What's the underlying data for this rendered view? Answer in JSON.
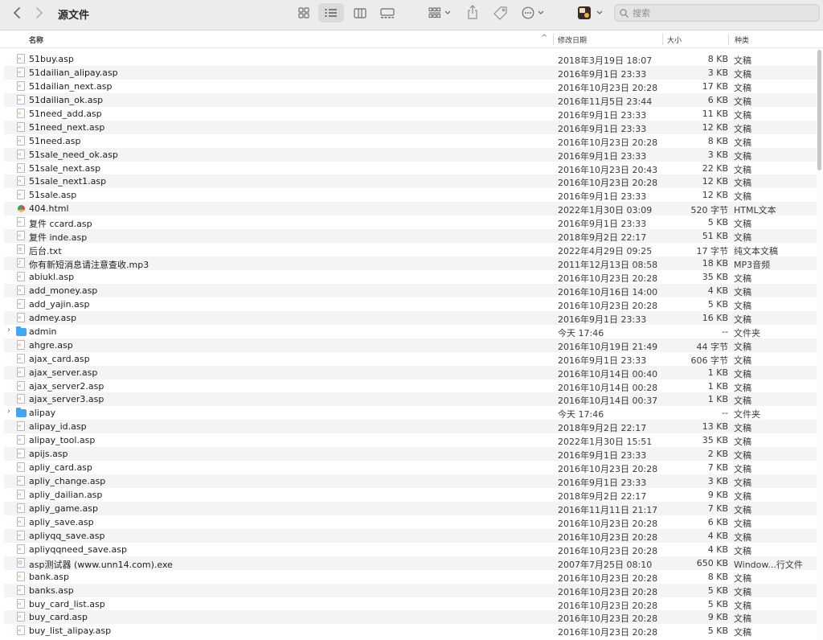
{
  "window": {
    "title": "源文件"
  },
  "toolbar": {
    "back_icon": "chevron-left-icon",
    "forward_icon": "chevron-right-icon",
    "search_placeholder": "搜索"
  },
  "header": {
    "name": "名称",
    "date": "修改日期",
    "size": "大小",
    "kind": "种类"
  },
  "files": [
    {
      "name": "51buy.asp",
      "date": "2018年3月19日 18:07",
      "size": "8 KB",
      "kind": "文稿",
      "type": "asp"
    },
    {
      "name": "51dailian_alipay.asp",
      "date": "2016年9月1日 23:33",
      "size": "3 KB",
      "kind": "文稿",
      "type": "asp"
    },
    {
      "name": "51dailian_next.asp",
      "date": "2016年10月23日 20:28",
      "size": "17 KB",
      "kind": "文稿",
      "type": "asp"
    },
    {
      "name": "51dailian_ok.asp",
      "date": "2016年11月5日 23:44",
      "size": "6 KB",
      "kind": "文稿",
      "type": "asp"
    },
    {
      "name": "51need_add.asp",
      "date": "2016年9月1日 23:33",
      "size": "11 KB",
      "kind": "文稿",
      "type": "asp"
    },
    {
      "name": "51need_next.asp",
      "date": "2016年9月1日 23:33",
      "size": "12 KB",
      "kind": "文稿",
      "type": "asp"
    },
    {
      "name": "51need.asp",
      "date": "2016年10月23日 20:28",
      "size": "8 KB",
      "kind": "文稿",
      "type": "asp"
    },
    {
      "name": "51sale_need_ok.asp",
      "date": "2016年9月1日 23:33",
      "size": "3 KB",
      "kind": "文稿",
      "type": "asp"
    },
    {
      "name": "51sale_next.asp",
      "date": "2016年10月23日 20:43",
      "size": "22 KB",
      "kind": "文稿",
      "type": "asp"
    },
    {
      "name": "51sale_next1.asp",
      "date": "2016年10月23日 20:28",
      "size": "12 KB",
      "kind": "文稿",
      "type": "asp"
    },
    {
      "name": "51sale.asp",
      "date": "2016年9月1日 23:33",
      "size": "12 KB",
      "kind": "文稿",
      "type": "asp"
    },
    {
      "name": "404.html",
      "date": "2022年1月30日 03:09",
      "size": "520 字节",
      "kind": "HTML文本",
      "type": "html"
    },
    {
      "name": "复件 ccard.asp",
      "date": "2016年9月1日 23:33",
      "size": "5 KB",
      "kind": "文稿",
      "type": "asp"
    },
    {
      "name": "复件 inde.asp",
      "date": "2018年9月2日 22:17",
      "size": "51 KB",
      "kind": "文稿",
      "type": "asp"
    },
    {
      "name": "后台.txt",
      "date": "2022年4月29日 09:25",
      "size": "17 字节",
      "kind": "纯文本文稿",
      "type": "txt"
    },
    {
      "name": "你有新短消息请注意查收.mp3",
      "date": "2011年12月13日 08:58",
      "size": "18 KB",
      "kind": "MP3音频",
      "type": "mp3"
    },
    {
      "name": "abiukl.asp",
      "date": "2016年10月23日 20:28",
      "size": "35 KB",
      "kind": "文稿",
      "type": "asp"
    },
    {
      "name": "add_money.asp",
      "date": "2016年10月16日 14:00",
      "size": "4 KB",
      "kind": "文稿",
      "type": "asp"
    },
    {
      "name": "add_yajin.asp",
      "date": "2016年10月23日 20:28",
      "size": "5 KB",
      "kind": "文稿",
      "type": "asp"
    },
    {
      "name": "admey.asp",
      "date": "2016年9月1日 23:33",
      "size": "16 KB",
      "kind": "文稿",
      "type": "asp"
    },
    {
      "name": "admin",
      "date": "今天 17:46",
      "size": "--",
      "kind": "文件夹",
      "type": "folder"
    },
    {
      "name": "ahgre.asp",
      "date": "2016年10月19日 21:49",
      "size": "44 字节",
      "kind": "文稿",
      "type": "asp"
    },
    {
      "name": "ajax_card.asp",
      "date": "2016年9月1日 23:33",
      "size": "606 字节",
      "kind": "文稿",
      "type": "asp"
    },
    {
      "name": "ajax_server.asp",
      "date": "2016年10月14日 00:40",
      "size": "1 KB",
      "kind": "文稿",
      "type": "asp"
    },
    {
      "name": "ajax_server2.asp",
      "date": "2016年10月14日 00:28",
      "size": "1 KB",
      "kind": "文稿",
      "type": "asp"
    },
    {
      "name": "ajax_server3.asp",
      "date": "2016年10月14日 00:37",
      "size": "1 KB",
      "kind": "文稿",
      "type": "asp"
    },
    {
      "name": "alipay",
      "date": "今天 17:46",
      "size": "--",
      "kind": "文件夹",
      "type": "folder"
    },
    {
      "name": "alipay_id.asp",
      "date": "2018年9月2日 22:17",
      "size": "13 KB",
      "kind": "文稿",
      "type": "asp"
    },
    {
      "name": "alipay_tool.asp",
      "date": "2022年1月30日 15:51",
      "size": "35 KB",
      "kind": "文稿",
      "type": "asp"
    },
    {
      "name": "apijs.asp",
      "date": "2016年9月1日 23:33",
      "size": "2 KB",
      "kind": "文稿",
      "type": "asp"
    },
    {
      "name": "apliy_card.asp",
      "date": "2016年10月23日 20:28",
      "size": "7 KB",
      "kind": "文稿",
      "type": "asp"
    },
    {
      "name": "apliy_change.asp",
      "date": "2016年9月1日 23:33",
      "size": "3 KB",
      "kind": "文稿",
      "type": "asp"
    },
    {
      "name": "apliy_dailian.asp",
      "date": "2018年9月2日 22:17",
      "size": "9 KB",
      "kind": "文稿",
      "type": "asp"
    },
    {
      "name": "apliy_game.asp",
      "date": "2016年11月11日 21:17",
      "size": "7 KB",
      "kind": "文稿",
      "type": "asp"
    },
    {
      "name": "apliy_save.asp",
      "date": "2016年10月23日 20:28",
      "size": "6 KB",
      "kind": "文稿",
      "type": "asp"
    },
    {
      "name": "apliyqq_save.asp",
      "date": "2016年10月23日 20:28",
      "size": "4 KB",
      "kind": "文稿",
      "type": "asp"
    },
    {
      "name": "apliyqqneed_save.asp",
      "date": "2016年10月23日 20:28",
      "size": "4 KB",
      "kind": "文稿",
      "type": "asp"
    },
    {
      "name": "asp测试器 (www.unn14.com).exe",
      "date": "2007年7月25日 08:10",
      "size": "650 KB",
      "kind": "Window...行文件",
      "type": "exe"
    },
    {
      "name": "bank.asp",
      "date": "2016年10月23日 20:28",
      "size": "8 KB",
      "kind": "文稿",
      "type": "asp"
    },
    {
      "name": "banks.asp",
      "date": "2016年10月23日 20:28",
      "size": "5 KB",
      "kind": "文稿",
      "type": "asp"
    },
    {
      "name": "buy_card_list.asp",
      "date": "2016年10月23日 20:28",
      "size": "5 KB",
      "kind": "文稿",
      "type": "asp"
    },
    {
      "name": "buy_card.asp",
      "date": "2016年10月23日 20:28",
      "size": "9 KB",
      "kind": "文稿",
      "type": "asp"
    },
    {
      "name": "buy_list_alipay.asp",
      "date": "2016年10月23日 20:28",
      "size": "5 KB",
      "kind": "文稿",
      "type": "asp"
    }
  ]
}
